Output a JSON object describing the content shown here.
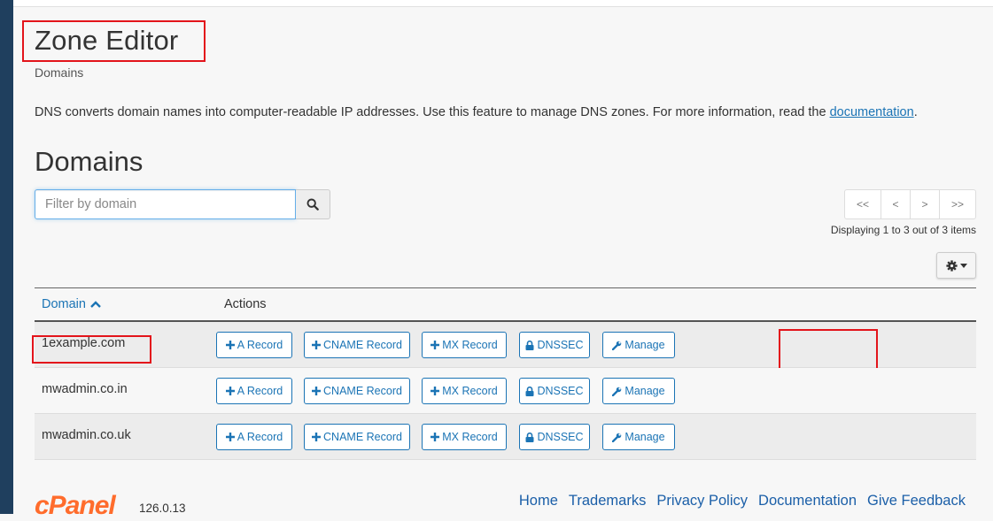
{
  "page": {
    "title": "Zone Editor",
    "breadcrumb": "Domains",
    "description_text": "DNS converts domain names into computer-readable IP addresses. Use this feature to manage DNS zones. For more information, read the",
    "description_link": "documentation",
    "description_end": ".",
    "section_title": "Domains"
  },
  "search": {
    "placeholder": "Filter by domain",
    "value": "",
    "button_icon": "search-icon"
  },
  "pagination": {
    "first": "<<",
    "prev": "<",
    "next": ">",
    "last": ">>",
    "displaying": "Displaying 1 to 3 out of 3 items"
  },
  "settings": {
    "icon": "gear-icon",
    "caret": "caret-down-icon"
  },
  "table": {
    "columns": {
      "domain": "Domain",
      "domain_sort_icon": "chevron-up-icon",
      "actions": "Actions"
    },
    "action_labels": {
      "a_record": "A Record",
      "cname_record": "CNAME Record",
      "mx_record": "MX Record",
      "dnssec": "DNSSEC",
      "manage": "Manage"
    },
    "rows": [
      {
        "domain": "1example.com"
      },
      {
        "domain": "mwadmin.co.in"
      },
      {
        "domain": "mwadmin.co.uk"
      }
    ]
  },
  "footer": {
    "logo": "cPanel",
    "version": "126.0.13",
    "links": [
      "Home",
      "Trademarks",
      "Privacy Policy",
      "Documentation",
      "Give Feedback"
    ]
  },
  "colors": {
    "accent": "#1b74b5",
    "highlight": "#e3141b",
    "brand": "#ff6c2c",
    "sidebar": "#1f3f5e"
  }
}
